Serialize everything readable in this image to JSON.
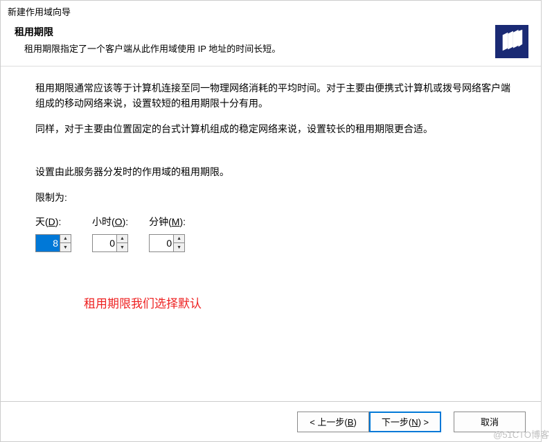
{
  "window": {
    "title": "新建作用域向导"
  },
  "header": {
    "title": "租用期限",
    "desc": "租用期限指定了一个客户端从此作用域使用 IP 地址的时间长短。"
  },
  "body": {
    "para1": "租用期限通常应该等于计算机连接至同一物理网络消耗的平均时间。对于主要由便携式计算机或拨号网络客户端组成的移动网络来说，设置较短的租用期限十分有用。",
    "para2": "同样，对于主要由位置固定的台式计算机组成的稳定网络来说，设置较长的租用期限更合适。",
    "para3": "设置由此服务器分发时的作用域的租用期限。",
    "limit_label": "限制为:",
    "days": {
      "label_prefix": "天(",
      "hotkey": "D",
      "label_suffix": "):",
      "value": "8"
    },
    "hours": {
      "label_prefix": "小时(",
      "hotkey": "O",
      "label_suffix": "):",
      "value": "0"
    },
    "minutes": {
      "label_prefix": "分钟(",
      "hotkey": "M",
      "label_suffix": "):",
      "value": "0"
    }
  },
  "annotation": "租用期限我们选择默认",
  "footer": {
    "back": {
      "pre": "< 上一步(",
      "hotkey": "B",
      "post": ")"
    },
    "next": {
      "pre": "下一步(",
      "hotkey": "N",
      "post": ") >"
    },
    "cancel": "取消"
  },
  "watermark": "@51CTO博客"
}
